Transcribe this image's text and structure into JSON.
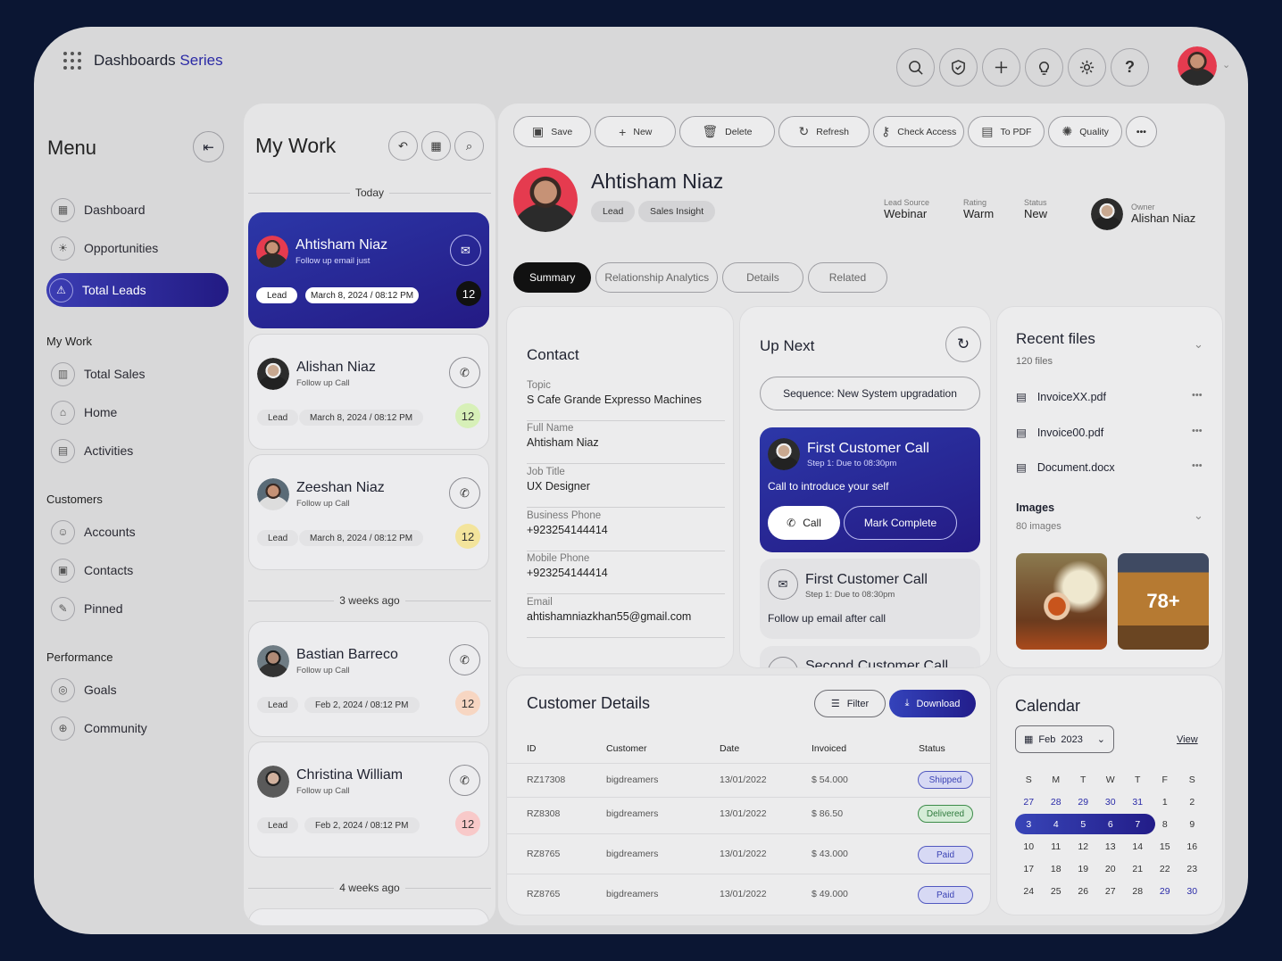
{
  "app": {
    "title": "Dashboards",
    "title_accent": "Series"
  },
  "top_icons": [
    "search-icon",
    "shield-icon",
    "plus-icon",
    "bulb-icon",
    "gear-icon",
    "help-icon"
  ],
  "menu": {
    "title": "Menu",
    "items": [
      {
        "label": "Dashboard",
        "icon": "dashboard-icon"
      },
      {
        "label": "Opportunities",
        "icon": "bulb-icon"
      },
      {
        "label": "Total Leads",
        "icon": "leads-icon",
        "active": true
      }
    ],
    "sections": [
      {
        "title": "My Work",
        "items": [
          {
            "label": "Total Sales",
            "icon": "chart-icon"
          },
          {
            "label": "Home",
            "icon": "home-icon"
          },
          {
            "label": "Activities",
            "icon": "activities-icon"
          }
        ]
      },
      {
        "title": "Customers",
        "items": [
          {
            "label": "Accounts",
            "icon": "user-icon"
          },
          {
            "label": "Contacts",
            "icon": "contacts-icon"
          },
          {
            "label": "Pinned",
            "icon": "pin-icon"
          }
        ]
      },
      {
        "title": "Performance",
        "items": [
          {
            "label": "Goals",
            "icon": "target-icon"
          },
          {
            "label": "Community",
            "icon": "globe-icon"
          }
        ]
      }
    ]
  },
  "work": {
    "title": "My Work",
    "groups": [
      "Today",
      "3 weeks ago",
      "4 weeks ago"
    ],
    "cards": [
      {
        "name": "Ahtisham Niaz",
        "sub": "Follow up email just",
        "tag": "Lead",
        "date": "March 8, 2024 / 08:12 PM",
        "count": "12",
        "badge_color": "#111111"
      },
      {
        "name": "Alishan Niaz",
        "sub": "Follow up Call",
        "tag": "Lead",
        "date": "March 8, 2024 / 08:12 PM",
        "count": "12",
        "badge_color": "#d7f0b8"
      },
      {
        "name": "Zeeshan Niaz",
        "sub": "Follow up Call",
        "tag": "Lead",
        "date": "March 8, 2024 / 08:12 PM",
        "count": "12",
        "badge_color": "#f3e49c"
      },
      {
        "name": "Bastian Barreco",
        "sub": "Follow up Call",
        "tag": "Lead",
        "date": "Feb 2, 2024 / 08:12 PM",
        "count": "12",
        "badge_color": "#f7d6c2"
      },
      {
        "name": "Christina William",
        "sub": "Follow up Call",
        "tag": "Lead",
        "date": "Feb 2, 2024 / 08:12 PM",
        "count": "12",
        "badge_color": "#f8c9c9"
      }
    ]
  },
  "toolbar": [
    "Save",
    "New",
    "Delete",
    "Refresh",
    "Check Access",
    "To PDF",
    "Quality"
  ],
  "profile": {
    "name": "Ahtisham Niaz",
    "pills": [
      "Lead",
      "Sales Insight"
    ],
    "meta": [
      {
        "label": "Lead Source",
        "value": "Webinar"
      },
      {
        "label": "Rating",
        "value": "Warm"
      },
      {
        "label": "Status",
        "value": "New"
      }
    ],
    "owner_label": "Owner",
    "owner": "Alishan Niaz"
  },
  "tabs": [
    "Summary",
    "Relationship Analytics",
    "Details",
    "Related"
  ],
  "contact": {
    "title": "Contact",
    "fields": [
      {
        "label": "Topic",
        "value": "S Cafe Grande Expresso Machines"
      },
      {
        "label": "Full Name",
        "value": "Ahtisham Niaz"
      },
      {
        "label": "Job Title",
        "value": "UX Designer"
      },
      {
        "label": "Business Phone",
        "value": "+923254144414"
      },
      {
        "label": "Mobile Phone",
        "value": "+923254144414"
      },
      {
        "label": "Email",
        "value": "ahtishamniazkhan55@gmail.com"
      }
    ]
  },
  "upnext": {
    "title": "Up Next",
    "sequence": "Sequence: New System upgradation",
    "active": {
      "title": "First Customer Call",
      "step": "Step 1: Due to 08:30pm",
      "desc": "Call to introduce your self",
      "call": "Call",
      "complete": "Mark Complete"
    },
    "second": {
      "title": "First Customer Call",
      "step": "Step 1: Due to 08:30pm",
      "desc": "Follow up email after call"
    },
    "third": {
      "title": "Second Customer Call"
    }
  },
  "files": {
    "title": "Recent files",
    "count": "120 files",
    "items": [
      "InvoiceXX.pdf",
      "Invoice00.pdf",
      "Document.docx"
    ],
    "images_title": "Images",
    "images_count": "80 images",
    "more": "78+"
  },
  "customers": {
    "title": "Customer Details",
    "filter": "Filter",
    "download": "Download",
    "headers": [
      "ID",
      "Customer",
      "Date",
      "Invoiced",
      "Status"
    ],
    "rows": [
      {
        "id": "RZ17308",
        "customer": "bigdreamers",
        "date": "13/01/2022",
        "invoiced": "$ 54.000",
        "status": "Shipped"
      },
      {
        "id": "RZ8308",
        "customer": "bigdreamers",
        "date": "13/01/2022",
        "invoiced": "$ 86.50",
        "status": "Delivered"
      },
      {
        "id": "RZ8765",
        "customer": "bigdreamers",
        "date": "13/01/2022",
        "invoiced": "$ 43.000",
        "status": "Paid"
      },
      {
        "id": "RZ8765",
        "customer": "bigdreamers",
        "date": "13/01/2022",
        "invoiced": "$ 49.000",
        "status": "Paid"
      }
    ]
  },
  "calendar": {
    "title": "Calendar",
    "month": "Feb",
    "year": "2023",
    "view": "View",
    "weekdays": [
      "S",
      "M",
      "T",
      "W",
      "T",
      "F",
      "S"
    ],
    "weeks": [
      [
        "27",
        "28",
        "29",
        "30",
        "31",
        "1",
        "2"
      ],
      [
        "3",
        "4",
        "5",
        "6",
        "7",
        "8",
        "9"
      ],
      [
        "10",
        "11",
        "12",
        "13",
        "14",
        "15",
        "16"
      ],
      [
        "17",
        "18",
        "19",
        "20",
        "21",
        "22",
        "23"
      ],
      [
        "24",
        "25",
        "26",
        "27",
        "28",
        "29",
        "30"
      ]
    ]
  }
}
